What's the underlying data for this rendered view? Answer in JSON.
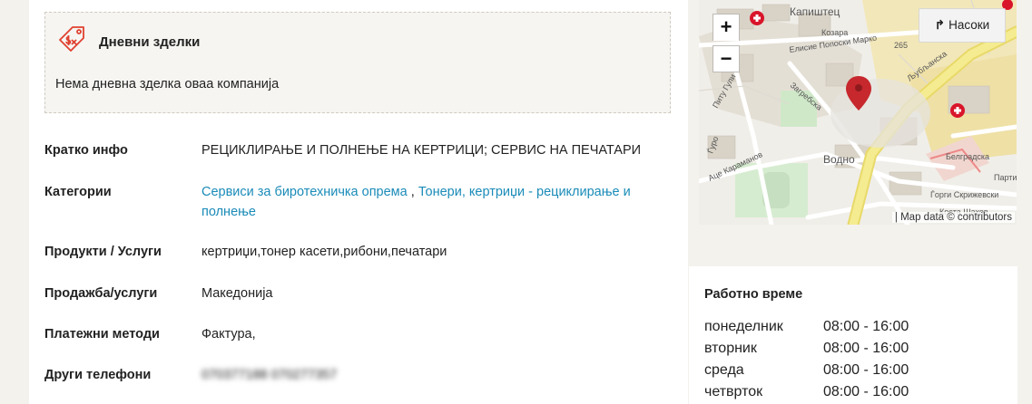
{
  "daily_deals": {
    "title": "Дневни зделки",
    "icon": "price-tag-icon",
    "empty_text": "Нема дневна зделка оваа компанија"
  },
  "info": {
    "short_info": {
      "label": "Кратко инфо",
      "value": "РЕЦИКЛИРАЊЕ И ПОЛНЕЊЕ НА КЕРТРИЦИ; СЕРВИС НА ПЕЧАТАРИ"
    },
    "categories": {
      "label": "Категории",
      "links": [
        "Сервиси за биротехничка опрема",
        "Тонери, кертриџи - рециклирање и полнење"
      ],
      "separator": " ,"
    },
    "products": {
      "label": "Продукти / Услуги",
      "value": "кертриџи,тонер касети,рибони,печатари"
    },
    "sales": {
      "label": "Продажба/услуги",
      "value": "Македонија"
    },
    "payment": {
      "label": "Платежни методи",
      "value": "Фактура,"
    },
    "phones": {
      "label": "Други телефони",
      "value": "070377188 070277357"
    }
  },
  "map": {
    "zoom_in": "+",
    "zoom_out": "−",
    "directions_label": "Насоки",
    "attribution": "| Map data © contributors",
    "street_labels": {
      "kapishtec": "Капиштец",
      "kozara": "Козара",
      "elisie": "Елисие Попоски Марко",
      "num": "265",
      "ljubljanska": "Љубљанска",
      "pitu_guli": "Питу Гули",
      "zagrebska": "Загребска",
      "karamanov": "Аце Караманов",
      "vodno": "Водно",
      "belgradska": "Белградска",
      "partizanska": "Парти",
      "gorgi": "Ѓорги Скрижевски",
      "kosta": "Коста Шахов"
    },
    "colors": {
      "background": "#ebe6dc",
      "main_road": "#f3e98a",
      "hospital": "#d9152a",
      "marker": "#c6282d"
    }
  },
  "hours": {
    "title": "Работно време",
    "days": [
      {
        "day": "понеделник",
        "time": "08:00 - 16:00"
      },
      {
        "day": "вторник",
        "time": "08:00 - 16:00"
      },
      {
        "day": "среда",
        "time": "08:00 - 16:00"
      },
      {
        "day": "четврток",
        "time": "08:00 - 16:00"
      }
    ]
  }
}
